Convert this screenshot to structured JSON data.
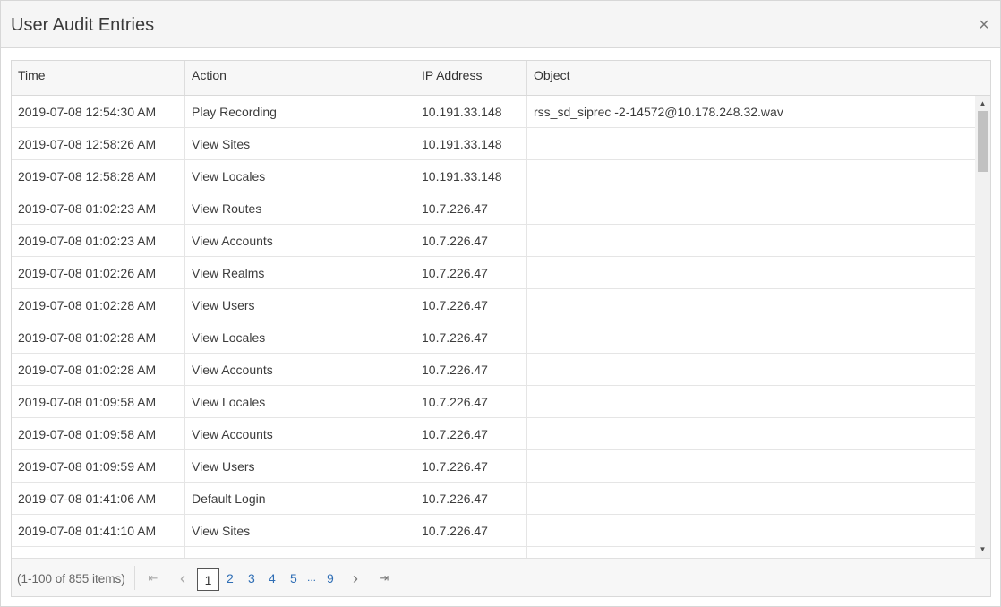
{
  "dialog": {
    "title": "User Audit Entries",
    "close_glyph": "×",
    "close_icon": "close-icon"
  },
  "table": {
    "columns": [
      "Time",
      "Action",
      "IP Address",
      "Object"
    ],
    "rows": [
      [
        "2019-07-08 12:54:30 AM",
        "Play Recording",
        "10.191.33.148",
        "rss_sd_siprec -2-14572@10.178.248.32.wav"
      ],
      [
        "2019-07-08 12:58:26 AM",
        "View Sites",
        "10.191.33.148",
        ""
      ],
      [
        "2019-07-08 12:58:28 AM",
        "View Locales",
        "10.191.33.148",
        ""
      ],
      [
        "2019-07-08 01:02:23 AM",
        "View Routes",
        "10.7.226.47",
        ""
      ],
      [
        "2019-07-08 01:02:23 AM",
        "View Accounts",
        "10.7.226.47",
        ""
      ],
      [
        "2019-07-08 01:02:26 AM",
        "View Realms",
        "10.7.226.47",
        ""
      ],
      [
        "2019-07-08 01:02:28 AM",
        "View Users",
        "10.7.226.47",
        ""
      ],
      [
        "2019-07-08 01:02:28 AM",
        "View Locales",
        "10.7.226.47",
        ""
      ],
      [
        "2019-07-08 01:02:28 AM",
        "View Accounts",
        "10.7.226.47",
        ""
      ],
      [
        "2019-07-08 01:09:58 AM",
        "View Locales",
        "10.7.226.47",
        ""
      ],
      [
        "2019-07-08 01:09:58 AM",
        "View Accounts",
        "10.7.226.47",
        ""
      ],
      [
        "2019-07-08 01:09:59 AM",
        "View Users",
        "10.7.226.47",
        ""
      ],
      [
        "2019-07-08 01:41:06 AM",
        "Default Login",
        "10.7.226.47",
        ""
      ],
      [
        "2019-07-08 01:41:10 AM",
        "View Sites",
        "10.7.226.47",
        ""
      ],
      [
        "",
        "",
        "",
        ""
      ]
    ]
  },
  "scrollbar": {
    "up_glyph": "▲",
    "down_glyph": "▼"
  },
  "pager": {
    "info": "(1-100 of 855 items)",
    "first_glyph": "⇤",
    "prev_glyph": "‹",
    "current_page": "1",
    "pages": [
      "2",
      "3",
      "4",
      "5"
    ],
    "ellipsis": "...",
    "last_page": "9",
    "next_glyph": "›",
    "last_glyph": "⇥"
  }
}
